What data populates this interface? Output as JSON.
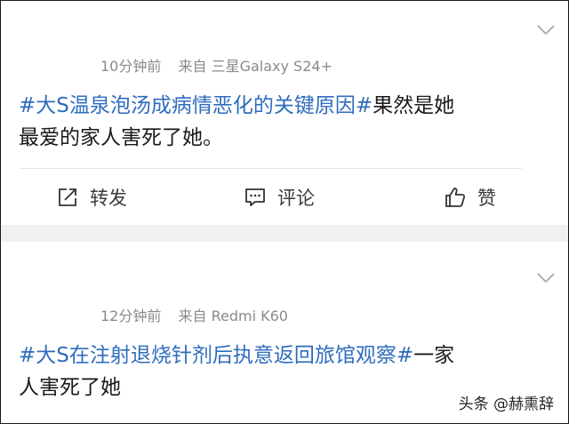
{
  "posts": [
    {
      "time": "10分钟前",
      "source_prefix": "来自",
      "device": "三星Galaxy S24+",
      "content": {
        "topic": "#大S温泉泡汤成病情恶化的关键原因#",
        "line1_rest": "果然是她",
        "line2": "最爱的家人害死了她。"
      },
      "actions": {
        "repost": "转发",
        "comment": "评论",
        "like": "赞"
      }
    },
    {
      "time": "12分钟前",
      "source_prefix": "来自",
      "device": "Redmi K60",
      "content": {
        "topic": "#大S在注射退烧针剂后执意返回旅馆观察#",
        "line1_rest": "一家",
        "line2": "人害死了她"
      }
    }
  ],
  "watermark": "头条 @赫熏辞",
  "colors": {
    "topic": "#2f6dbd",
    "meta": "#8a8a8a",
    "text": "#1a1a1a",
    "separator": "#f0f0f0"
  },
  "icons": {
    "repost": "share-box-icon",
    "comment": "comment-bubble-icon",
    "like": "thumbs-up-icon",
    "menu": "chevron-down-icon"
  }
}
